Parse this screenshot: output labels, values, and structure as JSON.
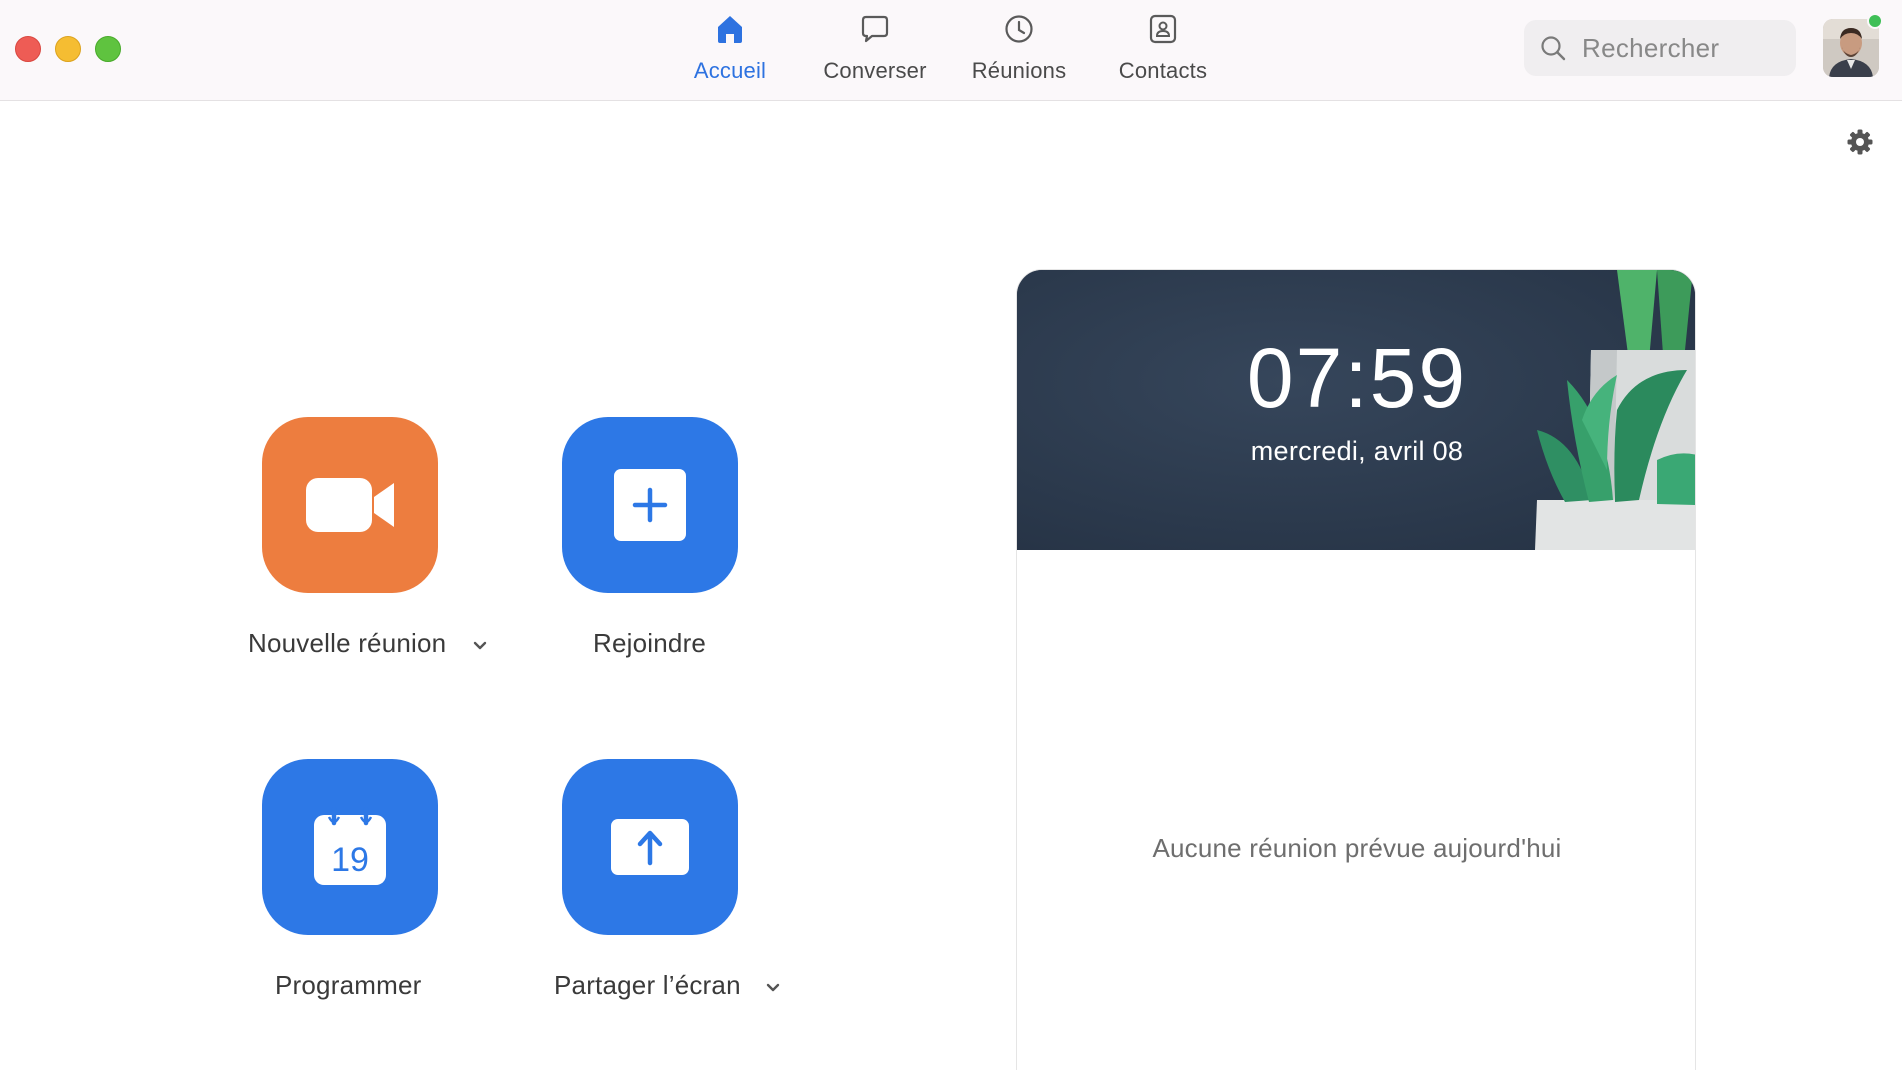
{
  "nav": {
    "tabs": [
      {
        "label": "Accueil",
        "icon": "home-icon",
        "active": true
      },
      {
        "label": "Converser",
        "icon": "chat-bubble-icon",
        "active": false
      },
      {
        "label": "Réunions",
        "icon": "clock-icon",
        "active": false
      },
      {
        "label": "Contacts",
        "icon": "contact-card-icon",
        "active": false
      }
    ]
  },
  "search": {
    "placeholder": "Rechercher"
  },
  "actions": [
    {
      "label": "Nouvelle réunion",
      "icon": "video-camera-icon",
      "color": "#ed7d3f",
      "has_dropdown": true
    },
    {
      "label": "Rejoindre",
      "icon": "plus-icon",
      "color": "#2d78e6",
      "has_dropdown": false
    },
    {
      "label": "Programmer",
      "icon": "calendar-icon",
      "color": "#2d78e6",
      "calendar_day": "19",
      "has_dropdown": false
    },
    {
      "label": "Partager l’écran",
      "icon": "share-screen-icon",
      "color": "#2d78e6",
      "has_dropdown": true
    }
  ],
  "meetings_panel": {
    "time": "07:59",
    "date": "mercredi, avril 08",
    "empty_message": "Aucune réunion prévue aujourd'hui"
  },
  "colors": {
    "accent": "#2d72e0",
    "online_status": "#3fbf57"
  }
}
